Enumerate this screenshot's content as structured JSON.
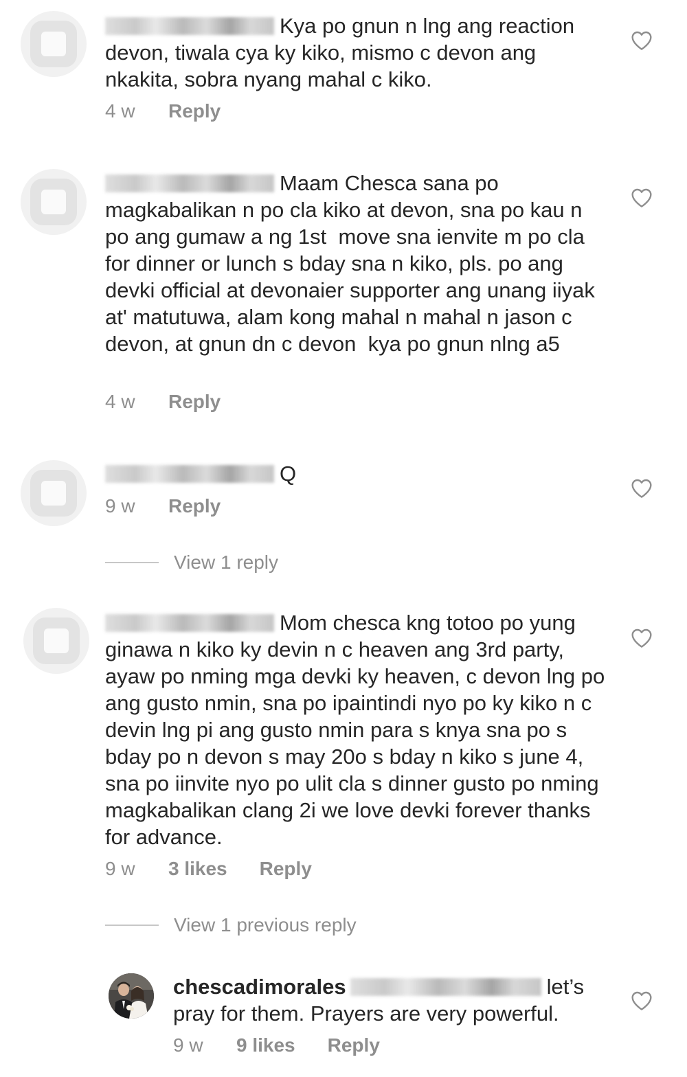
{
  "comments": [
    {
      "text": "Kya po gnun n lng ang reaction devon, tiwala cya ky kiko, mismo c devon ang nkakita, sobra nyang mahal c kiko.",
      "time": "4 w",
      "reply": "Reply",
      "liked": false
    },
    {
      "text": "Maam Chesca sana po magkabalikan n po cla kiko at devon, sna po kau n po ang gumaw a ng 1st  move sna ienvite m po cla for dinner or lunch s bday sna n kiko, pls. po ang devki official at devonaier supporter ang unang iiyak at' matutuwa, alam kong mahal n mahal n jason c devon, at gnun dn c devon  kya po gnun nlng a5",
      "time": "4 w",
      "reply": "Reply",
      "liked": false
    },
    {
      "text": "Q",
      "time": "9 w",
      "reply": "Reply",
      "view_replies": "View 1 reply",
      "liked": false
    },
    {
      "text": "Mom chesca kng totoo po yung ginawa n kiko ky devin n c heaven ang 3rd party, ayaw po nming mga devki ky heaven, c devon lng po ang gusto nmin, sna po ipaintindi nyo po ky kiko n c devin lng pi ang gusto nmin para s knya sna po s bday po n devon s may 20o s bday n kiko s june 4, sna po iinvite nyo po ulit cla s dinner gusto po nming magkabalikan clang 2i we love devki forever thanks for advance.",
      "time": "9 w",
      "likes": "3 likes",
      "reply": "Reply",
      "view_replies": "View 1 previous reply",
      "liked": false
    }
  ],
  "reply_comment": {
    "username": "chescadimorales",
    "text": "let’s pray for them. Prayers are very powerful.",
    "time": "9 w",
    "likes": "9 likes",
    "reply": "Reply",
    "liked": false
  },
  "icons": {
    "like": "heart-outline-icon"
  },
  "colors": {
    "text": "#262626",
    "secondary": "#8e8e8e",
    "divider": "#c7c7c7"
  }
}
